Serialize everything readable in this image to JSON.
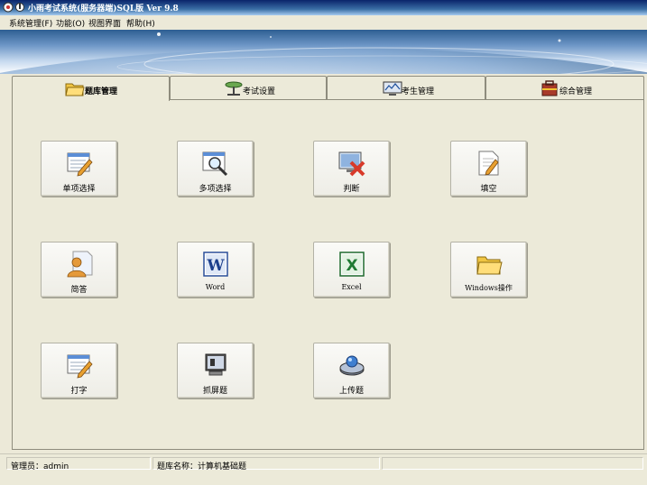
{
  "window": {
    "title": "小雨考试系统(服务器端)SQL版 Ver 9.8"
  },
  "menu": [
    {
      "label": "系统管理(F)"
    },
    {
      "label": "功能(O)"
    },
    {
      "label": "视图界面"
    },
    {
      "label": "帮助(H)"
    }
  ],
  "tabs": [
    {
      "label": "题库管理",
      "icon": "folder-icon",
      "selected": true
    },
    {
      "label": "考试设置",
      "icon": "lamp-icon",
      "selected": false
    },
    {
      "label": "考生管理",
      "icon": "monitor-icon",
      "selected": false
    },
    {
      "label": "综合管理",
      "icon": "toolbox-icon",
      "selected": false
    }
  ],
  "tiles": [
    {
      "label": "单项选择",
      "icon": "document-pencil-icon"
    },
    {
      "label": "多项选择",
      "icon": "magnifier-window-icon"
    },
    {
      "label": "判断",
      "icon": "monitor-cross-icon"
    },
    {
      "label": "填空",
      "icon": "page-pencil-icon"
    },
    {
      "label": "简答",
      "icon": "user-document-icon"
    },
    {
      "label": "Word",
      "icon": "word-icon"
    },
    {
      "label": "Excel",
      "icon": "excel-icon"
    },
    {
      "label": "Windows操作",
      "icon": "folder-icon"
    },
    {
      "label": "打字",
      "icon": "document-pencil-icon"
    },
    {
      "label": "抓屏题",
      "icon": "screen-capture-icon"
    },
    {
      "label": "上传题",
      "icon": "upload-icon"
    }
  ],
  "status": {
    "admin_label": "管理员：admin",
    "bank_label": "题库名称：计算机基础题"
  }
}
